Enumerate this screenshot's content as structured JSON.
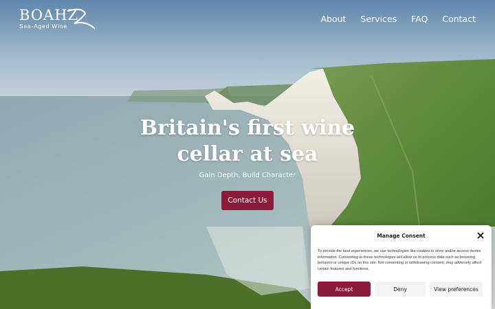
{
  "brand": {
    "name": "BOAHZ",
    "tagline": "Sea-Aged Wine"
  },
  "nav": [
    {
      "label": "About"
    },
    {
      "label": "Services"
    },
    {
      "label": "FAQ"
    },
    {
      "label": "Contact"
    }
  ],
  "hero": {
    "title_line1": "Britain's first wine",
    "title_line2": "cellar at sea",
    "subtitle": "Gain Depth, Build Character",
    "cta_label": "Contact Us"
  },
  "consent": {
    "title": "Manage Consent",
    "text": "To provide the best experiences, we use technologies like cookies to store and/or access device information. Consenting to these technologies will allow us to process data such as browsing behavior or unique IDs on this site. Not consenting or withdrawing consent, may adversely affect certain features and functions.",
    "accept_label": "Accept",
    "deny_label": "Deny",
    "preferences_label": "View preferences"
  },
  "colors": {
    "accent": "#8c1b3b",
    "sea": "#8fa9b3",
    "grass": "#5f8a3e",
    "cliff": "#e9e6dc"
  },
  "icons": {
    "close": "close-icon"
  }
}
